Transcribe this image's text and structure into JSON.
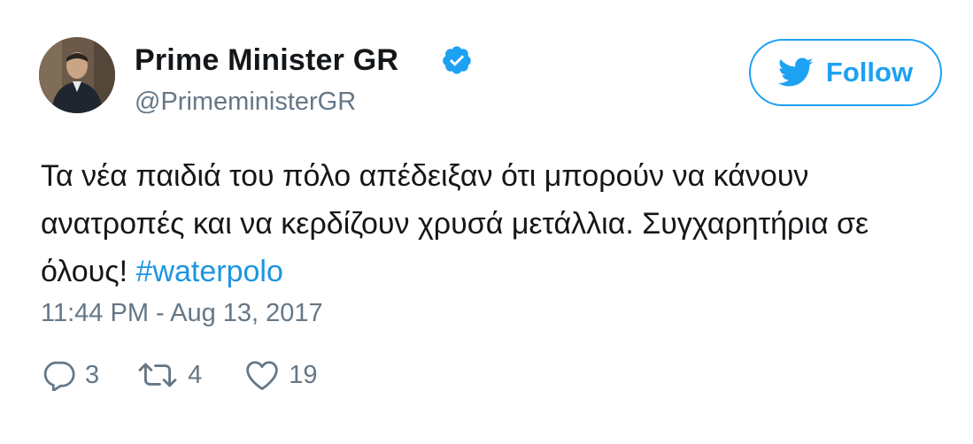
{
  "author": {
    "name": "Prime Minister GR",
    "handle": "@PrimeministerGR",
    "verified": true,
    "avatar": "profile-photo"
  },
  "follow_button": {
    "label": "Follow",
    "icon": "twitter-bird-icon",
    "color": "#1da1f2"
  },
  "tweet": {
    "text": "Τα νέα παιδιά του πόλο απέδειξαν ότι μπορούν να κάνουν ανατροπές και να κερδίζουν χρυσά μετάλλια. Συγχαρητήρια σε όλους! ",
    "hashtag": "#waterpolo",
    "timestamp": "11:44 PM - Aug 13, 2017"
  },
  "actions": {
    "reply": {
      "icon": "reply-icon",
      "count": "3"
    },
    "retweet": {
      "icon": "retweet-icon",
      "count": "4"
    },
    "like": {
      "icon": "heart-icon",
      "count": "19"
    }
  },
  "colors": {
    "text": "#14171a",
    "secondary": "#657786",
    "accent": "#1da1f2",
    "hashtag": "#1b95e0"
  }
}
